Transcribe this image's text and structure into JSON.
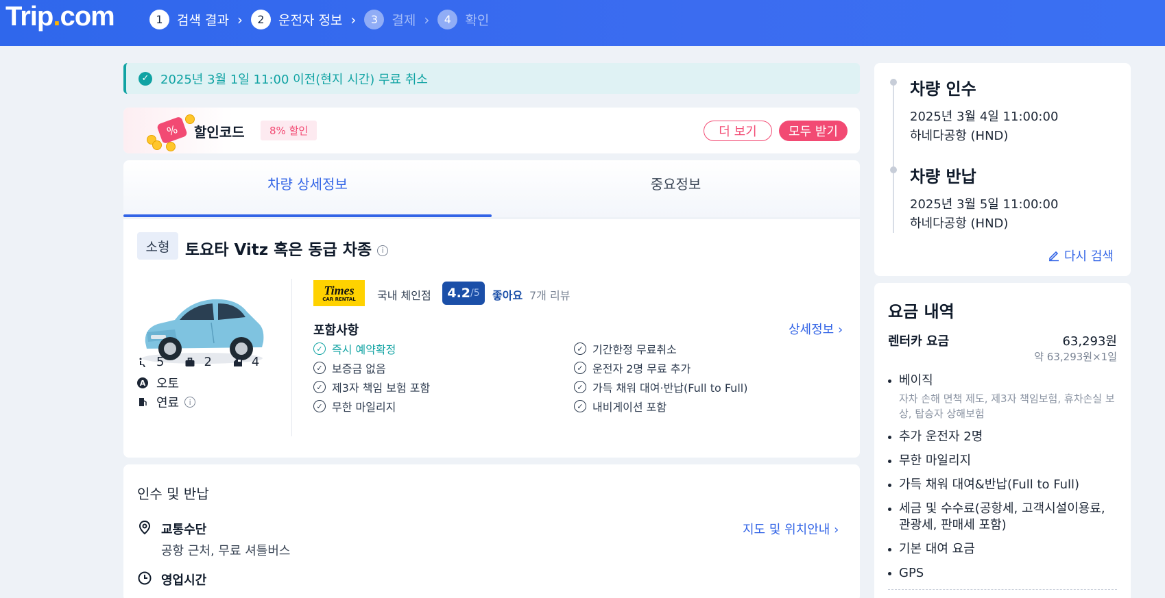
{
  "header": {
    "logo_main": "Trip",
    "logo_dot": ".",
    "logo_tail": "com",
    "steps": [
      {
        "num": "1",
        "label": "검색 결과"
      },
      {
        "num": "2",
        "label": "운전자 정보"
      },
      {
        "num": "3",
        "label": "결제"
      },
      {
        "num": "4",
        "label": "확인"
      }
    ],
    "arrow": "›"
  },
  "notice": {
    "text": "2025년 3월 1일 11:00 이전(현지 시간) 무료 취소",
    "icon": "check-circle-icon"
  },
  "coupon": {
    "title": "할인코드",
    "pill": "8% 할인",
    "more_button": "더 보기",
    "claim_all_button": "모두 받기",
    "tag_symbol": "%"
  },
  "tabs": [
    {
      "label": "차량 상세정보",
      "active": true
    },
    {
      "label": "중요정보",
      "active": false
    }
  ],
  "car": {
    "type_badge": "소형",
    "name": "토요타 Vitz 혹은 동급 차종",
    "info_glyph": "i",
    "specs": {
      "seats": "5",
      "luggage": "2",
      "doors": "4",
      "transmission": "오토",
      "transmission_glyph": "A",
      "fuel": "연료"
    },
    "vendor_logo_text": "Times",
    "vendor_logo_sub": "CAR RENTAL",
    "vendor_type": "국내 체인점",
    "rating": "4.2",
    "rating_den": "/5",
    "rating_label": "좋아요",
    "reviews": "7개 리뷰",
    "includes_title": "포함사항",
    "details_link": "상세정보 ›",
    "includes_left": [
      "즉시 예약확정",
      "보증금 없음",
      "제3자 책임 보험 포함",
      "무한 마일리지"
    ],
    "includes_right": [
      "기간한정 무료취소",
      "운전자 2명 무료 추가",
      "가득 채워 대여·반납(Full to Full)",
      "내비게이션 포함"
    ],
    "check_glyph": "✓"
  },
  "pickup_section": {
    "title": "인수 및 반납",
    "transport_label": "교통수단",
    "transport_value": "공항 근처, 무료 셔틀버스",
    "map_link": "지도 및 위치안내 ›",
    "hours_label": "영업시간"
  },
  "trip": {
    "pickup_heading": "차량 인수",
    "pickup_datetime": "2025년 3월 4일 11:00:00",
    "pickup_location": "하네다공항 (HND)",
    "return_heading": "차량 반납",
    "return_datetime": "2025년 3월 5일 11:00:00",
    "return_location": "하네다공항 (HND)",
    "research_link": "다시 검색"
  },
  "fare": {
    "title": "요금 내역",
    "rental_label": "렌터카 요금",
    "rental_amount": "63,293원",
    "rental_sub": "약 63,293원×1일",
    "items": [
      {
        "label": "베이직",
        "sub": "자차 손해 면책 제도, 제3자 책임보험, 휴차손실 보상, 탑승자 상해보험"
      },
      {
        "label": "추가 운전자 2명"
      },
      {
        "label": "무한 마일리지"
      },
      {
        "label": "가득 채워 대여&반납(Full to Full)"
      },
      {
        "label": "세금 및 수수료(공항세, 고객시설이용료, 관광세, 판매세 포함)"
      },
      {
        "label": "기본 대여 요금"
      },
      {
        "label": "GPS"
      }
    ]
  },
  "colors": {
    "brand_blue": "#3264e6",
    "teal": "#10a3a3",
    "pink": "#f24a73",
    "rating_blue": "#1b4fa8",
    "times_yellow": "#ffd200"
  }
}
